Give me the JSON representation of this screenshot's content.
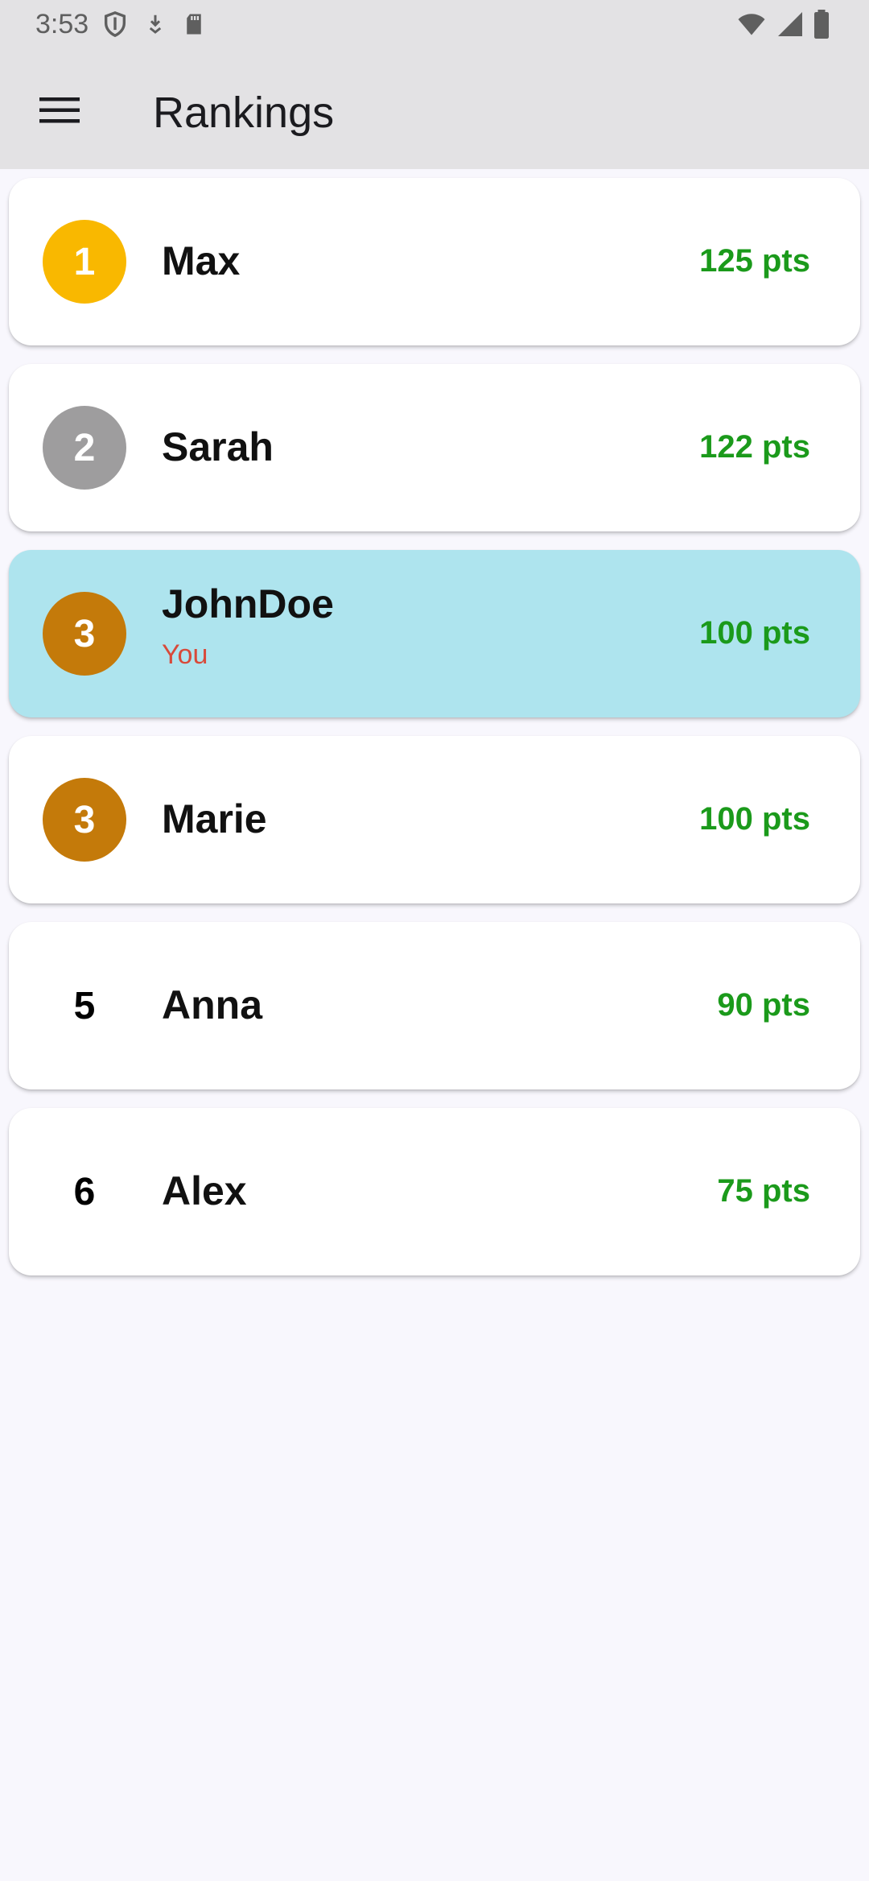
{
  "status_bar": {
    "time": "3:53",
    "left_icons": [
      "shield-icon",
      "download-icon",
      "sd-card-icon"
    ],
    "right_icons": [
      "wifi-icon",
      "cell-signal-icon",
      "battery-icon"
    ]
  },
  "app_bar": {
    "menu_icon": "menu-icon",
    "title": "Rankings"
  },
  "colors": {
    "gold": "#F9B800",
    "silver": "#9E9D9E",
    "bronze": "#C47A0A",
    "points": "#1B9A1B",
    "highlight": "#AEE4EE",
    "you": "#D84A3A"
  },
  "rankings": [
    {
      "rank": "1",
      "name": "Max",
      "points": "125 pts",
      "medal": "gold"
    },
    {
      "rank": "2",
      "name": "Sarah",
      "points": "122 pts",
      "medal": "silver"
    },
    {
      "rank": "3",
      "name": "JohnDoe",
      "points": "100 pts",
      "medal": "bronze",
      "sublabel": "You",
      "is_current_user": true
    },
    {
      "rank": "3",
      "name": "Marie",
      "points": "100 pts",
      "medal": "bronze"
    },
    {
      "rank": "5",
      "name": "Anna",
      "points": "90 pts",
      "medal": "none"
    },
    {
      "rank": "6",
      "name": "Alex",
      "points": "75 pts",
      "medal": "none"
    }
  ]
}
